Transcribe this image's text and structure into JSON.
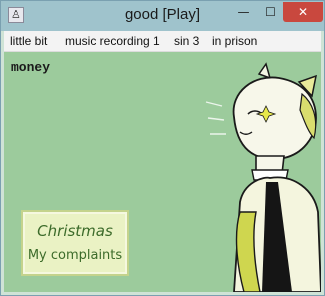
{
  "window": {
    "title": "good [Play]",
    "icon_glyph": "♙",
    "controls": {
      "minimize": "—",
      "maximize": "☐",
      "close": "✕"
    }
  },
  "menu": {
    "items": [
      {
        "label": "little bit"
      },
      {
        "label": "music recording 1"
      },
      {
        "label": "sin 3"
      },
      {
        "label": "in prison"
      }
    ]
  },
  "hud": {
    "money_label": "money"
  },
  "choices": [
    {
      "label": "Christmas"
    },
    {
      "label": "My complaints"
    }
  ],
  "colors": {
    "stage_background": "#9ccb9c",
    "choice_text": "#3c6b2a",
    "choice_box": "#eaf2c4",
    "close_button": "#c9483e",
    "titlebar": "#9fc3cc"
  },
  "character": {
    "icon": "cat-character-portrait"
  }
}
